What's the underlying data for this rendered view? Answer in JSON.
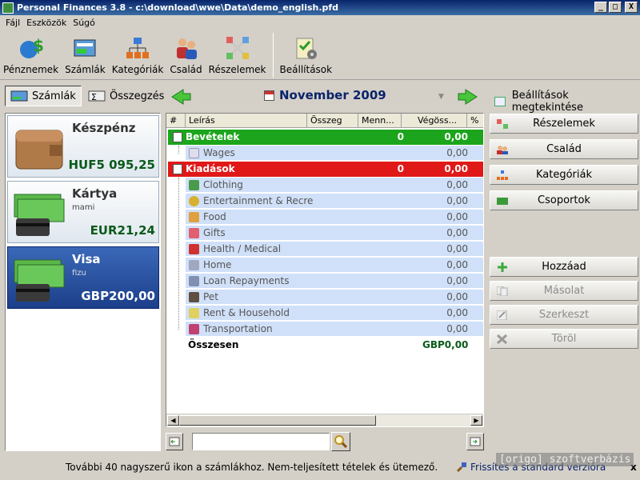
{
  "window": {
    "title": "Personal Finances 3.8 - c:\\download\\wwe\\Data\\demo_english.pfd",
    "min": "_",
    "max": "□",
    "close": "X"
  },
  "menu": [
    "Fájl",
    "Eszközök",
    "Súgó"
  ],
  "toolbar": [
    "Pénznemek",
    "Számlák",
    "Kategóriák",
    "Család",
    "Részelemek",
    "Beállítások"
  ],
  "nav": {
    "accounts_tab": "Számlák",
    "summary_tab": "Összegzés",
    "month": "November 2009",
    "settings_view": "Beállítások megtekintése"
  },
  "accounts": [
    {
      "name": "Készpénz",
      "sub": "",
      "balance": "HUF5 095,25"
    },
    {
      "name": "Kártya",
      "sub": "mami",
      "balance": "EUR21,24"
    },
    {
      "name": "Visa",
      "sub": "fizu",
      "balance": "GBP200,00"
    }
  ],
  "grid": {
    "headers": [
      "#",
      "Leírás",
      "Összeg",
      "Menn...",
      "Végöss...",
      "%"
    ],
    "income": {
      "label": "Bevételek",
      "count": "0",
      "total": "0,00"
    },
    "income_items": [
      {
        "label": "Wages",
        "total": "0,00"
      }
    ],
    "expense": {
      "label": "Kiadások",
      "count": "0",
      "total": "0,00"
    },
    "expense_items": [
      {
        "label": "Clothing",
        "total": "0,00"
      },
      {
        "label": "Entertainment & Recre",
        "total": "0,00"
      },
      {
        "label": "Food",
        "total": "0,00"
      },
      {
        "label": "Gifts",
        "total": "0,00"
      },
      {
        "label": "Health / Medical",
        "total": "0,00"
      },
      {
        "label": "Home",
        "total": "0,00"
      },
      {
        "label": "Loan Repayments",
        "total": "0,00"
      },
      {
        "label": "Pet",
        "total": "0,00"
      },
      {
        "label": "Rent & Household",
        "total": "0,00"
      },
      {
        "label": "Transportation",
        "total": "0,00"
      }
    ],
    "total_label": "Összesen",
    "total_value": "GBP0,00"
  },
  "right_buttons": [
    "Részelemek",
    "Család",
    "Kategóriák",
    "Csoportok"
  ],
  "action_buttons": [
    {
      "label": "Hozzáad",
      "enabled": true
    },
    {
      "label": "Másolat",
      "enabled": false
    },
    {
      "label": "Szerkeszt",
      "enabled": false
    },
    {
      "label": "Töröl",
      "enabled": false
    }
  ],
  "status": {
    "message": "További 40 nagyszerű ikon a számlákhoz. Nem-teljesített tételek és ütemező.",
    "link": "Frissítés a standard verzióra",
    "close": "x"
  },
  "watermark": "[origo] szoftverbázis"
}
